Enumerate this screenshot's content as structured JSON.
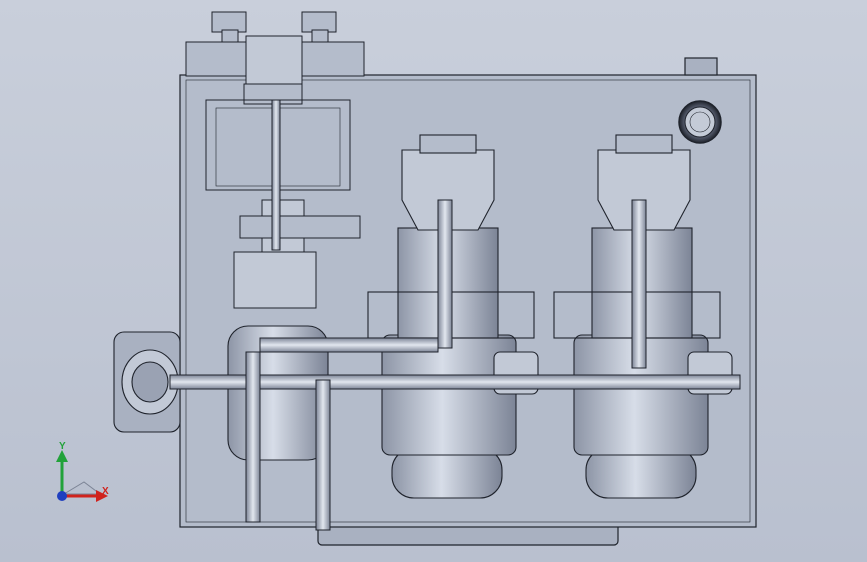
{
  "viewport": {
    "background_top": "#c9cfdb",
    "background_bottom": "#b9c0cf",
    "model_color": "#b4bccb",
    "line_color": "#1f232c"
  },
  "model": {
    "name": "",
    "components": [
      "valve-manifold",
      "motor-pump-1",
      "motor-pump-2",
      "gear-pump",
      "oil-tank",
      "filler-cap",
      "piping"
    ]
  },
  "triad": {
    "y_label": "Y",
    "x_label": "X",
    "y_color": "#22a23a",
    "x_color": "#d0231d",
    "z_color": "#1f3fbf"
  }
}
